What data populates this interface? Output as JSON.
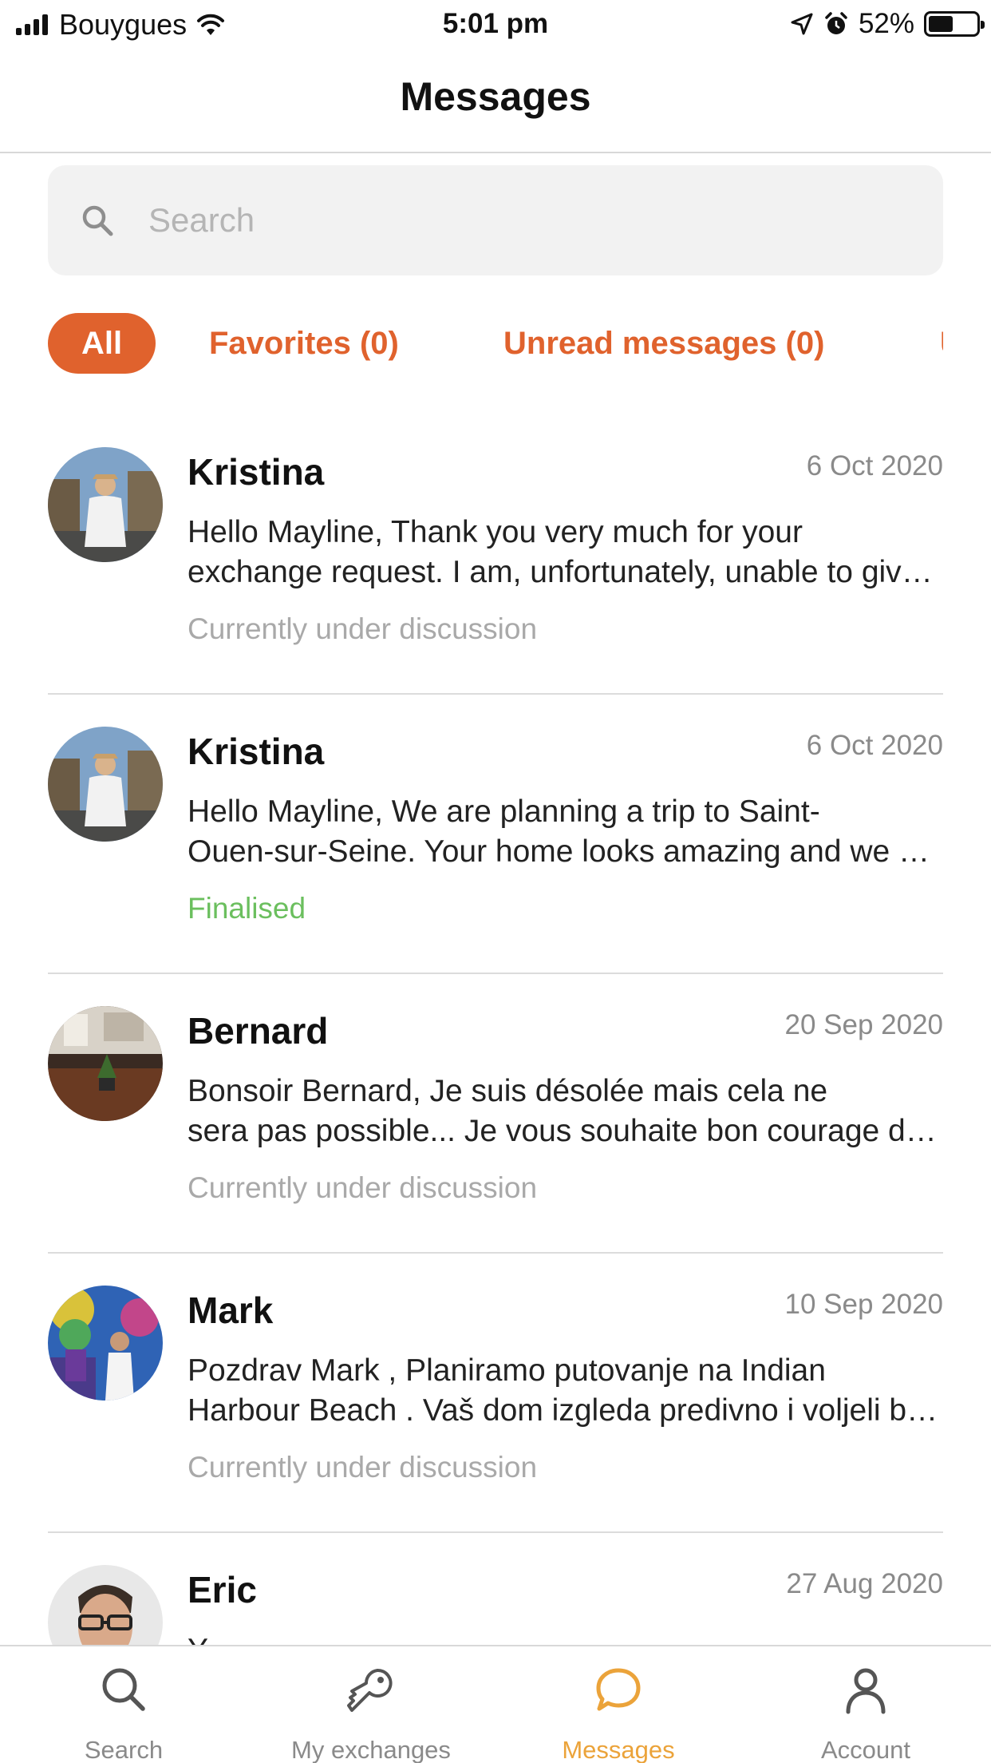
{
  "status_bar": {
    "carrier": "Bouygues",
    "time": "5:01 pm",
    "battery": "52%",
    "battery_level": 0.52
  },
  "header": {
    "title": "Messages"
  },
  "search": {
    "placeholder": "Search"
  },
  "filters": [
    {
      "label": "All",
      "active": true
    },
    {
      "label": "Favorites (0)"
    },
    {
      "label": "Unread messages (0)"
    },
    {
      "label": "U"
    }
  ],
  "conversations": [
    {
      "name": "Kristina",
      "date": "6 Oct 2020",
      "line1": "Hello Mayline, Thank you very much for your",
      "line2": "exchange request. I am, unfortunately, unable to give a positive answer",
      "status": "Currently under discussion",
      "status_color": "#a9a9a9"
    },
    {
      "name": "Kristina",
      "date": "6 Oct 2020",
      "line1": "Hello Mayline,  We are planning a trip to Saint-",
      "line2": "Ouen-sur-Seine. Your home looks amazing and we would love to",
      "status": "Finalised",
      "status_color": "#6bbf5e"
    },
    {
      "name": "Bernard",
      "date": "20 Sep 2020",
      "line1": "Bonsoir Bernard, Je suis désolée mais cela ne",
      "line2": "sera pas possible... Je vous souhaite bon courage dans vos recherches",
      "status": "Currently under discussion",
      "status_color": "#a9a9a9"
    },
    {
      "name": "Mark",
      "date": "10 Sep 2020",
      "line1": "Pozdrav Mark ,  Planiramo putovanje na Indian",
      "line2": "Harbour Beach . Vaš dom izgleda predivno i voljeli bismo",
      "status": "Currently under discussion",
      "status_color": "#a9a9a9"
    },
    {
      "name": "Eric",
      "date": "27 Aug 2020",
      "line1": "Y",
      "line2": "",
      "status": "",
      "status_color": "#a9a9a9"
    }
  ],
  "tabs": [
    {
      "label": "Search",
      "icon": "search-icon"
    },
    {
      "label": "My exchanges",
      "icon": "key-icon"
    },
    {
      "label": "Messages",
      "icon": "chat-bubble-icon",
      "active": true
    },
    {
      "label": "Account",
      "icon": "person-icon"
    }
  ],
  "colors": {
    "accent": "#e0622d",
    "active_tab": "#eba33a",
    "finalised": "#6bbf5e"
  }
}
